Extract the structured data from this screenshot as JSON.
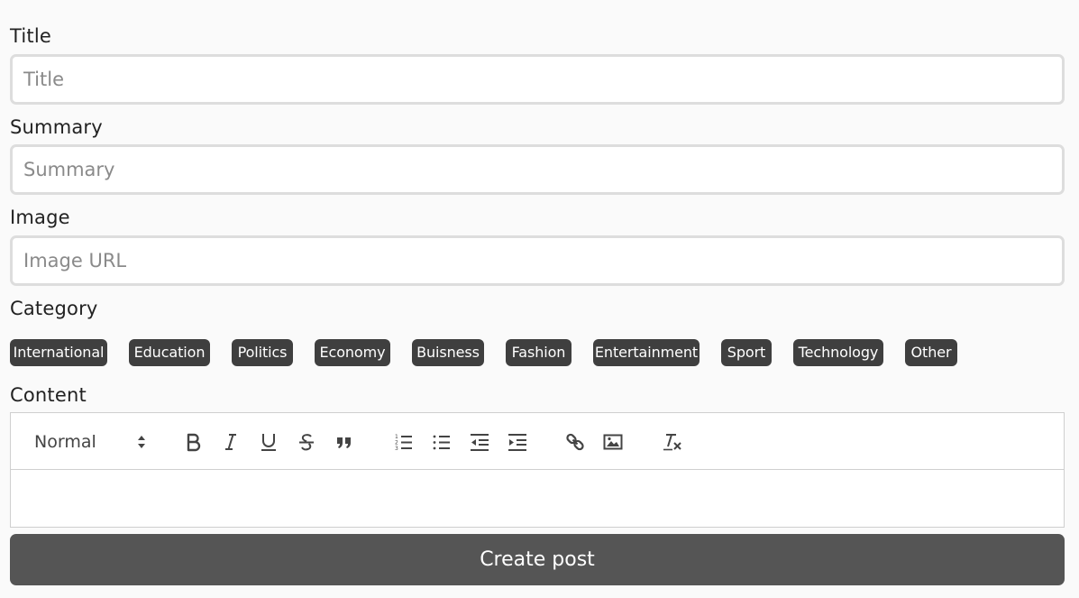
{
  "form": {
    "title_label": "Title",
    "title_placeholder": "Title",
    "summary_label": "Summary",
    "summary_placeholder": "Summary",
    "image_label": "Image",
    "image_placeholder": "Image URL",
    "category_label": "Category",
    "categories": [
      "International",
      "Education",
      "Politics",
      "Economy",
      "Buisness",
      "Fashion",
      "Entertainment",
      "Sport",
      "Technology",
      "Other"
    ],
    "content_label": "Content",
    "submit_label": "Create post"
  },
  "editor": {
    "header_value": "Normal",
    "tools": [
      "bold-icon",
      "italic-icon",
      "underline-icon",
      "strikethrough-icon",
      "blockquote-icon",
      "ordered-list-icon",
      "bullet-list-icon",
      "outdent-icon",
      "indent-icon",
      "link-icon",
      "image-icon",
      "clear-format-icon"
    ]
  },
  "colors": {
    "chip_bg": "#3f3f3f",
    "button_bg": "#555555",
    "input_border": "#dddddd"
  }
}
